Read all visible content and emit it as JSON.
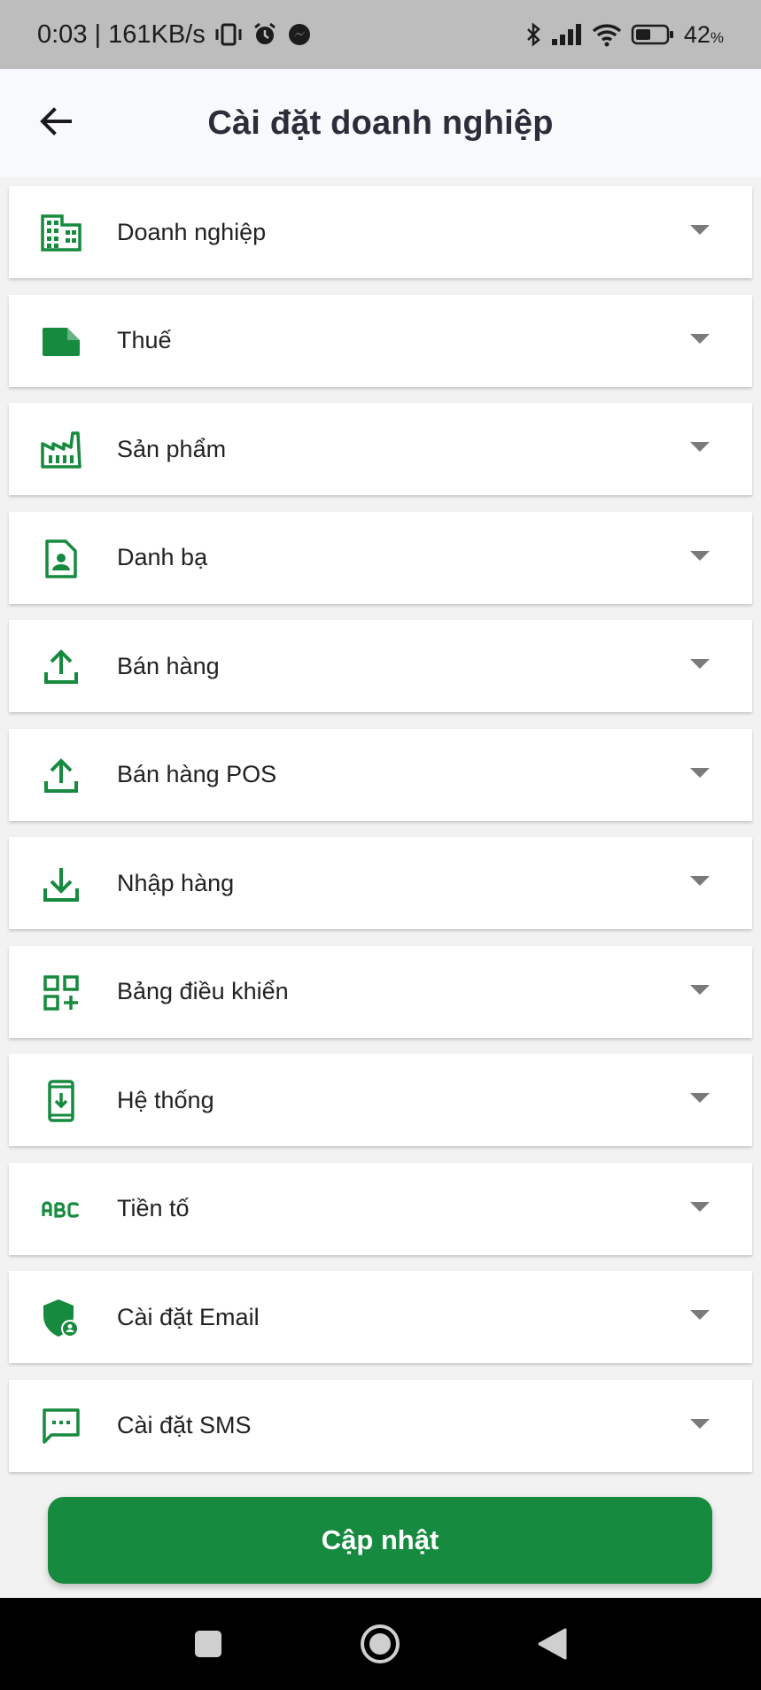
{
  "status_bar": {
    "time_speed": "0:03 | 161KB/s",
    "battery_level": "42",
    "battery_unit": "%",
    "icons": [
      "vibrate-icon",
      "alarm-icon",
      "messenger-icon",
      "bluetooth-icon",
      "signal-icon",
      "wifi-icon",
      "battery-icon"
    ]
  },
  "header": {
    "title": "Cài đặt doanh nghiệp",
    "back_icon": "arrow-left-icon"
  },
  "settings": {
    "items": [
      {
        "label": "Doanh nghiệp",
        "icon": "business-icon"
      },
      {
        "label": "Thuế",
        "icon": "tax-note-icon"
      },
      {
        "label": "Sản phẩm",
        "icon": "factory-icon"
      },
      {
        "label": "Danh bạ",
        "icon": "contact-file-icon"
      },
      {
        "label": "Bán hàng",
        "icon": "upload-icon"
      },
      {
        "label": "Bán hàng POS",
        "icon": "upload-icon"
      },
      {
        "label": "Nhập hàng",
        "icon": "download-icon"
      },
      {
        "label": "Bảng điều khiển",
        "icon": "dashboard-add-icon"
      },
      {
        "label": "Hệ thống",
        "icon": "phone-download-icon"
      },
      {
        "label": "Tiền tố",
        "icon": "abc-icon"
      },
      {
        "label": "Cài đặt Email",
        "icon": "admin-shield-icon"
      },
      {
        "label": "Cài đặt SMS",
        "icon": "sms-icon"
      }
    ],
    "expand_icon": "caret-down-icon"
  },
  "actions": {
    "update_label": "Cập nhật"
  },
  "colors": {
    "accent": "#168a3e",
    "status_bar_bg": "#bdbdbd",
    "header_bg": "#f7f9fc",
    "page_bg": "#f2f2f2",
    "nav_bar_bg": "#000000"
  },
  "nav_bar": {
    "icons": [
      "recents-square-icon",
      "home-circle-icon",
      "back-triangle-icon"
    ]
  }
}
